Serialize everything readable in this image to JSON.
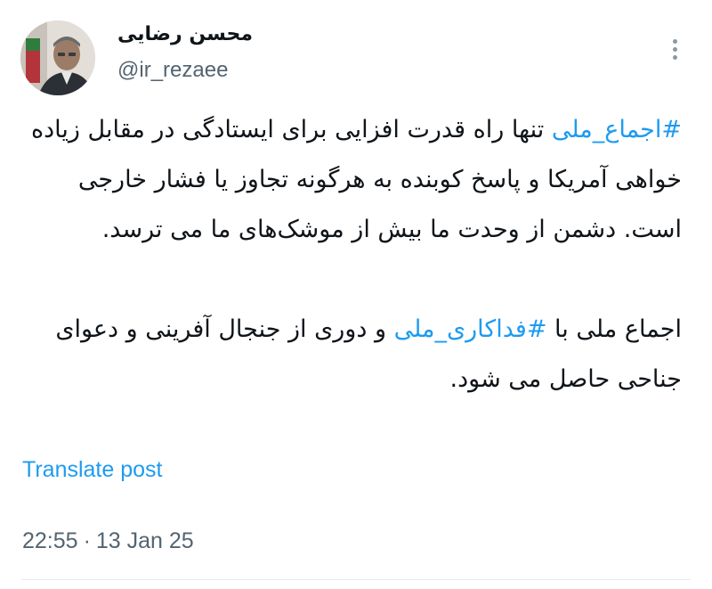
{
  "tweet": {
    "author": {
      "display_name": "محسن رضایی",
      "handle": "@ir_rezaee",
      "avatar_icon": "profile-photo"
    },
    "more_icon": "more-vertical-icon",
    "body": {
      "para1": {
        "hashtag": "#اجماع_ملی",
        "text": " تنها راه قدرت افزایی برای ایستادگی در مقابل زیاده خواهی آمریکا و پاسخ کوبنده به هرگونه تجاوز یا فشار خارجی است. دشمن از وحدت ما بیش از موشک‌های ما می ترسد."
      },
      "para2": {
        "text_before": "اجماع ملی با ",
        "hashtag": "#فداکاری_ملی",
        "text_after": " و دوری از جنجال آفرینی و دعوای جناحی حاصل می شود."
      }
    },
    "translate_label": "Translate post",
    "time": "22:55",
    "separator": "·",
    "date": "13 Jan 25",
    "colors": {
      "link": "#1d9bf0",
      "text": "#0f1419",
      "secondary": "#536471"
    }
  }
}
